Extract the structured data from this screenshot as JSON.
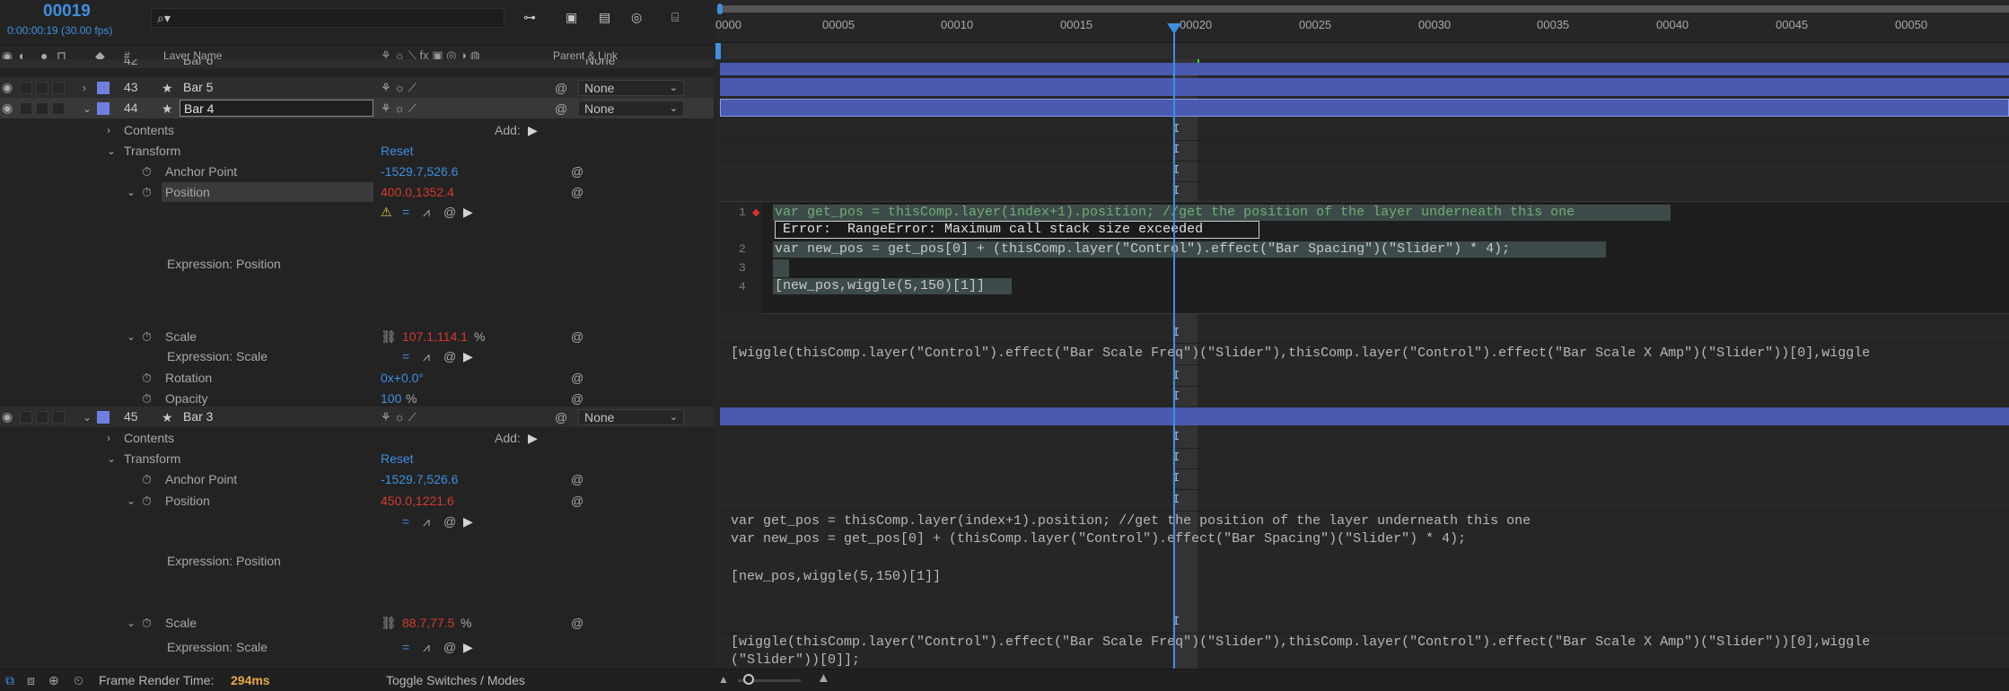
{
  "header": {
    "timecode": "00019",
    "timecode_sub": "0:00:00:19 (30.00 fps)",
    "search_placeholder": "⌕▾"
  },
  "columns": {
    "hash": "#",
    "layer_name": "Layer Name",
    "parent_link": "Parent & Link"
  },
  "timeline": {
    "ticks": [
      "0000",
      "00005",
      "00010",
      "00015",
      "00020",
      "00025",
      "00030",
      "00035",
      "00040",
      "00045",
      "00050"
    ]
  },
  "layers": [
    {
      "num": "42",
      "name": "Bar 6",
      "parent": "None"
    },
    {
      "num": "43",
      "name": "Bar 5",
      "parent": "None"
    },
    {
      "num": "44",
      "name": "Bar 4",
      "parent": "None"
    },
    {
      "num": "45",
      "name": "Bar 3",
      "parent": "None"
    }
  ],
  "bar4": {
    "contents": "Contents",
    "add_label": "Add:",
    "transform": "Transform",
    "reset": "Reset",
    "anchor_label": "Anchor Point",
    "anchor_value": "-1529.7,526.6",
    "position_label": "Position",
    "position_value": "400.0,1352.4",
    "expr_position": "Expression: Position",
    "scale_label": "Scale",
    "scale_value": "107.1,114.1",
    "scale_unit": "%",
    "expr_scale": "Expression: Scale",
    "rotation_label": "Rotation",
    "rotation_value": "0x+0.0°",
    "opacity_label": "Opacity",
    "opacity_value": "100",
    "opacity_unit": "%"
  },
  "bar3": {
    "contents": "Contents",
    "add_label": "Add:",
    "transform": "Transform",
    "reset": "Reset",
    "anchor_label": "Anchor Point",
    "anchor_value": "-1529.7,526.6",
    "position_label": "Position",
    "position_value": "450.0,1221.6",
    "expr_position": "Expression: Position",
    "scale_label": "Scale",
    "scale_value": "88.7,77.5",
    "scale_unit": "%",
    "expr_scale": "Expression: Scale"
  },
  "editor": {
    "line_numbers": [
      "1",
      "2",
      "3",
      "4"
    ],
    "line1": "var get_pos = thisComp.layer(index+1).position; //get the position of the layer underneath this one",
    "error": "Error:  RangeError: Maximum call stack size exceeded",
    "line2": "var new_pos = get_pos[0] + (thisComp.layer(\"Control\").effect(\"Bar Spacing\")(\"Slider\") * 4);",
    "line4": "[new_pos,wiggle(5,150)[1]]"
  },
  "scale_expr_text": "[wiggle(thisComp.layer(\"Control\").effect(\"Bar Scale Freq\")(\"Slider\"),thisComp.layer(\"Control\").effect(\"Bar Scale X Amp\")(\"Slider\"))[0],wiggle",
  "bar3_expr": {
    "line1": "var get_pos = thisComp.layer(index+1).position; //get the position of the layer underneath this one",
    "line2": "var new_pos = get_pos[0] + (thisComp.layer(\"Control\").effect(\"Bar Spacing\")(\"Slider\") * 4);",
    "line4": "[new_pos,wiggle(5,150)[1]]",
    "scale_line1": "[wiggle(thisComp.layer(\"Control\").effect(\"Bar Scale Freq\")(\"Slider\"),thisComp.layer(\"Control\").effect(\"Bar Scale X Amp\")(\"Slider\"))[0],wiggle",
    "scale_line2": "(\"Slider\"))[0]];"
  },
  "footer": {
    "render_label": "Frame Render Time:",
    "render_value": "294ms",
    "toggle": "Toggle Switches / Modes"
  },
  "colors": {
    "accent_blue": "#3f8fe0",
    "error_red": "#d23a2e",
    "layer_label": "#6f7fe0",
    "track_bar": "#4a5ab0",
    "playhead": "#3f8fe0",
    "render_value": "#e8a94a"
  }
}
